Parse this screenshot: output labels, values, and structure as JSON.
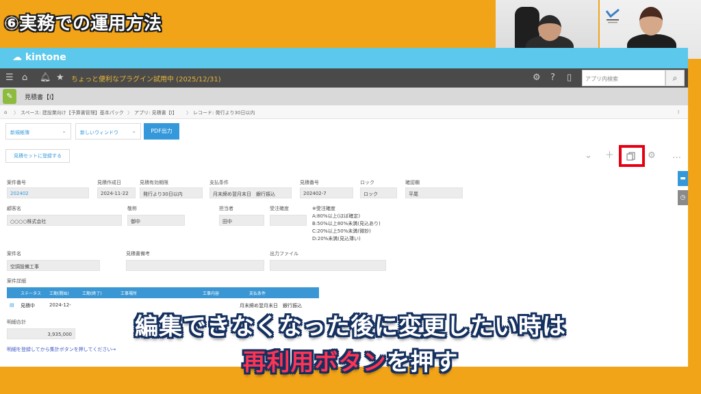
{
  "video": {
    "title": "⑥実務での運用方法",
    "subtitle_line1": "編集できなくなった後に変更したい時は",
    "subtitle_line2_highlight": "再利用ボタン",
    "subtitle_line2_rest": "を押す"
  },
  "kintone": {
    "logo": "kintone",
    "nav_title": "ちょっと便利なプラグイン試用中 (2025/12/31)",
    "search_placeholder": "アプリ内検索",
    "app_title": "見積書【I】",
    "breadcrumb": {
      "space": "スペース: 建設業向け【予算書管理】基本パック",
      "app": "アプリ: 見積書【I】",
      "record": "レコード: 発行より30日以内"
    },
    "select_1": "新規帳簿",
    "select_2": "新しいウィンドウ",
    "pdf_button": "PDF出力",
    "save_set_button": "見積セットに登録する",
    "fields": {
      "case_no_label": "案件番号",
      "case_no": "202402",
      "created_label": "見積作成日",
      "created": "2024-11-22",
      "validity_label": "見積有効期限",
      "validity": "発行より30日以内",
      "payment_label": "支払条件",
      "payment": "月末締め翌月末日　銀行振込",
      "quote_no_label": "見積番号",
      "quote_no": "202402-7",
      "lock_label": "ロック",
      "lock": "ロック",
      "confirmer_label": "確認欄",
      "confirmer": "平尾",
      "customer_label": "顧客名",
      "customer": "○○○○株式会社",
      "honorific_label": "敬称",
      "honorific": "御中",
      "staff_label": "担当者",
      "staff": "田中",
      "order_label": "受注確度",
      "order": "",
      "order_note_title": "※受注確度",
      "order_note_a": "A:80%以上(ほぼ確定)",
      "order_note_b": "B:50%以上80%未満(見込あり)",
      "order_note_c": "C:20%以上50%未満(微妙)",
      "order_note_d": "D:20%未満(見込薄い)",
      "case_name_label": "案件名",
      "case_name": "空調設備工事",
      "quote_memo_label": "見積書備考",
      "quote_memo": "",
      "output_file_label": "出力ファイル",
      "output_file": "",
      "detail_label": "案件詳細",
      "total_label": "明細合計",
      "total": "3,935,000"
    },
    "table": {
      "headers": [
        "ステータス",
        "工期(開始)",
        "工期(終了)",
        "工事場所",
        "工事内容",
        "支払条件"
      ],
      "row": {
        "status": "見積中",
        "start": "2024-12-",
        "payment": "月末締め翌月末日　銀行振込"
      }
    },
    "link_note": "明細を登録してから集計ボタンを押してください→"
  },
  "colors": {
    "frame": "#f2a418",
    "kintone_bar": "#5bc8ec",
    "highlight": "#e60012"
  }
}
